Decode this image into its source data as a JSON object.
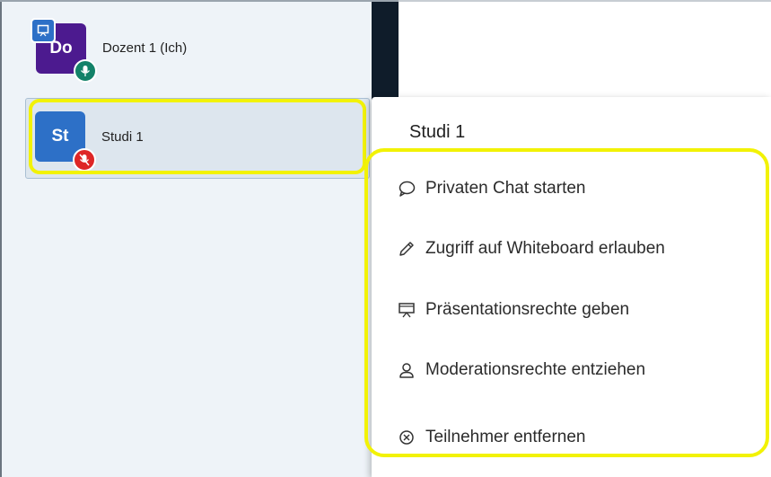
{
  "users": [
    {
      "initials": "Do",
      "name": "Dozent 1 (Ich)",
      "color": "#4c1a8f",
      "mic": "on",
      "presenter": true
    },
    {
      "initials": "St",
      "name": "Studi 1",
      "color": "#2d70c7",
      "mic": "muted",
      "presenter": false
    }
  ],
  "menu": {
    "title": "Studi 1",
    "items": [
      {
        "label": "Privaten Chat starten",
        "icon": "chat-bubble-icon"
      },
      {
        "label": "Zugriff auf Whiteboard erlauben",
        "icon": "pencil-icon"
      },
      {
        "label": "Präsentationsrechte geben",
        "icon": "presentation-icon"
      },
      {
        "label": "Moderationsrechte entziehen",
        "icon": "user-icon"
      },
      {
        "label": "Teilnehmer entfernen",
        "icon": "close-circle-icon"
      }
    ]
  },
  "colors": {
    "highlight": "#f2f205",
    "sidebar_bg": "#eef3f8",
    "dark_strip": "#0f1c2a",
    "mic_on": "#138269",
    "mic_muted": "#de2626"
  }
}
